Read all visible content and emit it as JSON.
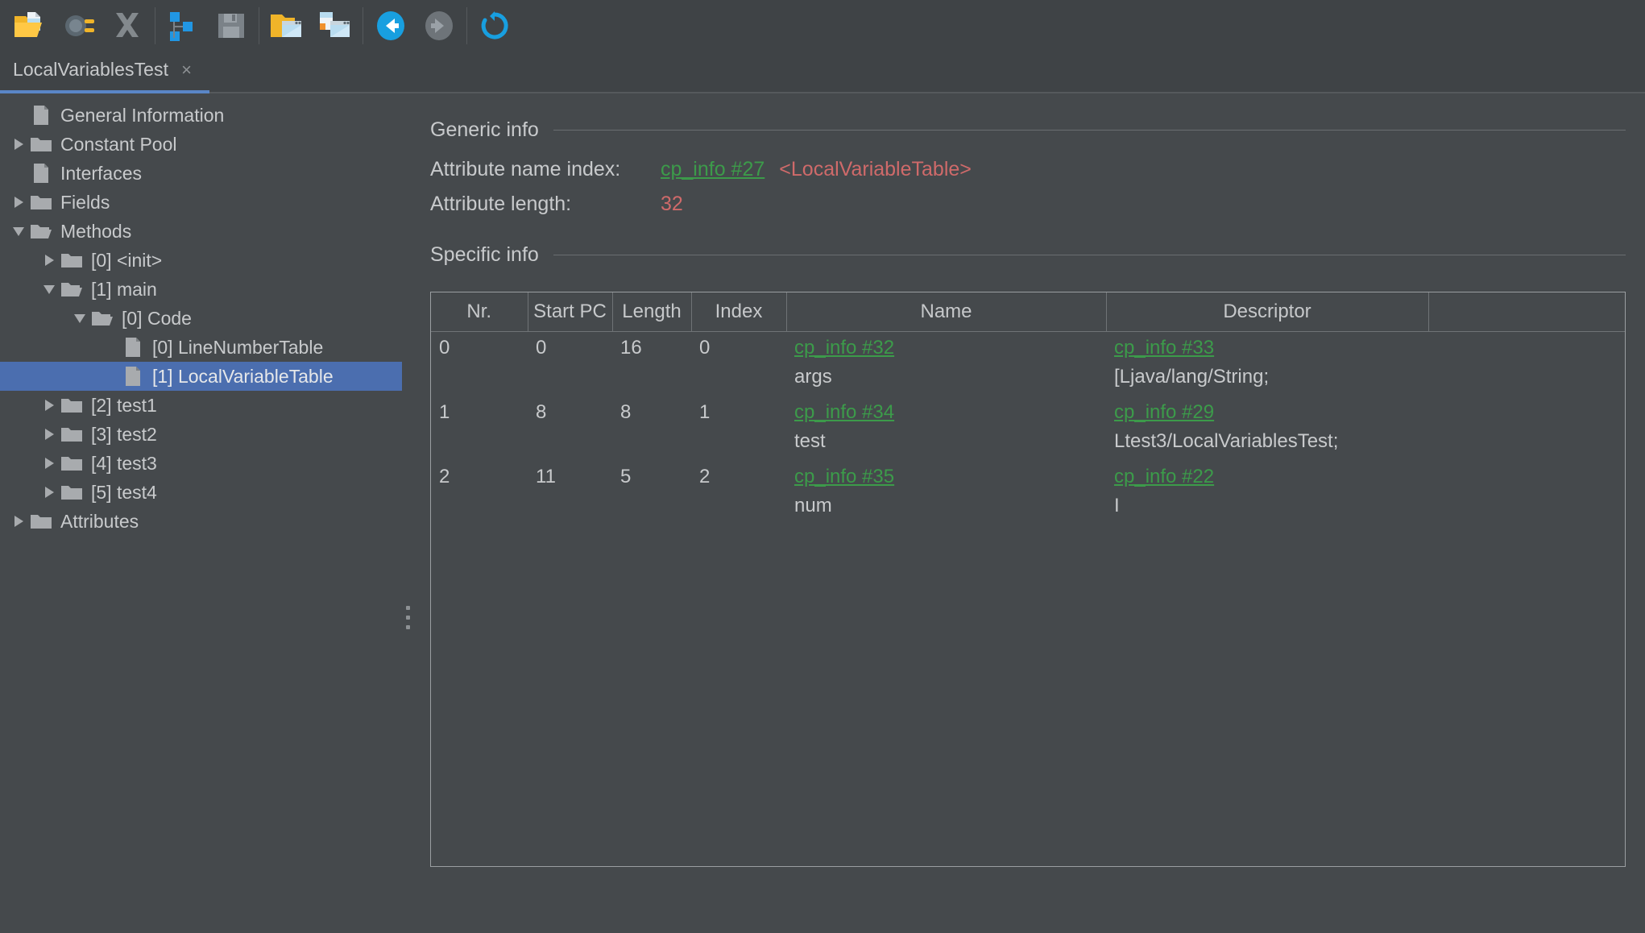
{
  "toolbar": {
    "buttons": [
      {
        "name": "open-class-file-button",
        "icon": "open-folder-document-icon",
        "label": "Open class file"
      },
      {
        "name": "browse-classpath-button",
        "icon": "plug-icon",
        "label": "Browse classpath"
      },
      {
        "name": "close-button",
        "icon": "close-x-icon",
        "label": "Close"
      },
      {
        "name": "expand-tree-button",
        "icon": "tree-nodes-icon",
        "label": "Expand tree"
      },
      {
        "name": "save-button",
        "icon": "floppy-disk-icon",
        "label": "Save"
      },
      {
        "name": "open-window-button",
        "icon": "folder-window-icon",
        "label": "Open window"
      },
      {
        "name": "new-window-button",
        "icon": "new-window-icon",
        "label": "New window"
      },
      {
        "name": "back-button",
        "icon": "arrow-left-circle-icon",
        "label": "Back"
      },
      {
        "name": "forward-button",
        "icon": "arrow-right-circle-icon",
        "label": "Forward"
      },
      {
        "name": "reload-button",
        "icon": "reload-icon",
        "label": "Reload"
      }
    ]
  },
  "tabs": [
    {
      "label": "LocalVariablesTest",
      "close": "×",
      "active": true
    }
  ],
  "sidebar": {
    "items": [
      {
        "label": "General Information",
        "icon": "page-icon",
        "twisty": "none",
        "indent": 0,
        "selected": false
      },
      {
        "label": "Constant Pool",
        "icon": "folder-icon",
        "twisty": "collapsed",
        "indent": 0,
        "selected": false
      },
      {
        "label": "Interfaces",
        "icon": "page-icon",
        "twisty": "none",
        "indent": 0,
        "selected": false
      },
      {
        "label": "Fields",
        "icon": "folder-icon",
        "twisty": "collapsed",
        "indent": 0,
        "selected": false
      },
      {
        "label": "Methods",
        "icon": "folder-open-icon",
        "twisty": "expanded",
        "indent": 0,
        "selected": false
      },
      {
        "label": "[0] <init>",
        "icon": "folder-icon",
        "twisty": "collapsed",
        "indent": 1,
        "selected": false
      },
      {
        "label": "[1] main",
        "icon": "folder-open-icon",
        "twisty": "expanded",
        "indent": 1,
        "selected": false
      },
      {
        "label": "[0] Code",
        "icon": "folder-open-icon",
        "twisty": "expanded",
        "indent": 2,
        "selected": false
      },
      {
        "label": "[0] LineNumberTable",
        "icon": "page-icon",
        "twisty": "none",
        "indent": 3,
        "selected": false
      },
      {
        "label": "[1] LocalVariableTable",
        "icon": "page-icon",
        "twisty": "none",
        "indent": 3,
        "selected": true
      },
      {
        "label": "[2] test1",
        "icon": "folder-icon",
        "twisty": "collapsed",
        "indent": 1,
        "selected": false
      },
      {
        "label": "[3] test2",
        "icon": "folder-icon",
        "twisty": "collapsed",
        "indent": 1,
        "selected": false
      },
      {
        "label": "[4] test3",
        "icon": "folder-icon",
        "twisty": "collapsed",
        "indent": 1,
        "selected": false
      },
      {
        "label": "[5] test4",
        "icon": "folder-icon",
        "twisty": "collapsed",
        "indent": 1,
        "selected": false
      },
      {
        "label": "Attributes",
        "icon": "folder-icon",
        "twisty": "collapsed",
        "indent": 0,
        "selected": false
      }
    ]
  },
  "detail": {
    "generic_info": {
      "heading": "Generic info",
      "rows": [
        {
          "key": "Attribute name index:",
          "link": "cp_info #27",
          "note": "<LocalVariableTable>"
        },
        {
          "key": "Attribute length:",
          "value": "32"
        }
      ]
    },
    "specific_info": {
      "heading": "Specific info",
      "table": {
        "columns": [
          "Nr.",
          "Start PC",
          "Length",
          "Index",
          "Name",
          "Descriptor",
          ""
        ],
        "rows": [
          {
            "nr": "0",
            "start_pc": "0",
            "length": "16",
            "index": "0",
            "name_link": "cp_info #32",
            "name_value": "args",
            "descriptor_link": "cp_info #33",
            "descriptor_value": "[Ljava/lang/String;"
          },
          {
            "nr": "1",
            "start_pc": "8",
            "length": "8",
            "index": "1",
            "name_link": "cp_info #34",
            "name_value": "test",
            "descriptor_link": "cp_info #29",
            "descriptor_value": "Ltest3/LocalVariablesTest;"
          },
          {
            "nr": "2",
            "start_pc": "11",
            "length": "5",
            "index": "2",
            "name_link": "cp_info #35",
            "name_value": "num",
            "descriptor_link": "cp_info #22",
            "descriptor_value": "I"
          }
        ]
      }
    }
  },
  "colors": {
    "background": "#45494c",
    "toolbar_bg": "#3f4346",
    "selection": "#4b6eaf",
    "tab_underline": "#5a86c7",
    "link_green": "#3c9b4a",
    "note_red": "#cf6a6a",
    "text": "#c8cacc"
  }
}
